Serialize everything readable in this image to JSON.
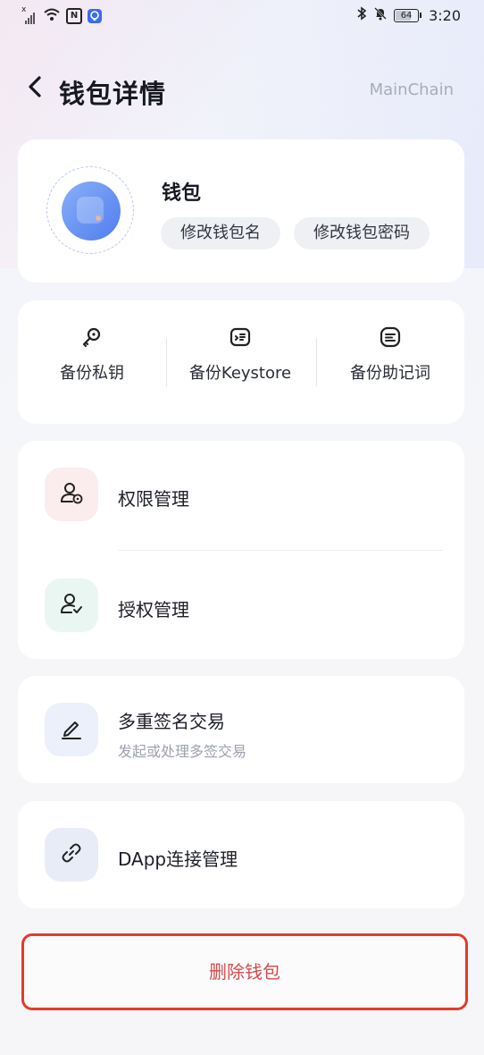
{
  "status_bar": {
    "time": "3:20",
    "battery": "64",
    "signal_marker": "x",
    "nfc": "N",
    "left_icons": [
      "signal-icon",
      "wifi-icon",
      "nfc-icon",
      "app-notification-icon"
    ],
    "right_icons": [
      "bluetooth-icon",
      "mute-bell-icon",
      "battery-icon"
    ]
  },
  "header": {
    "title": "钱包详情",
    "chain": "MainChain",
    "back_icon": "chevron-left-icon"
  },
  "wallet": {
    "name": "钱包",
    "rename_label": "修改钱包名",
    "change_password_label": "修改钱包密码",
    "avatar_color": "#5d89f2"
  },
  "backup": {
    "items": [
      {
        "label": "备份私钥",
        "icon": "key-icon"
      },
      {
        "label": "备份Keystore",
        "icon": "keystore-icon"
      },
      {
        "label": "备份助记词",
        "icon": "mnemonic-icon"
      }
    ]
  },
  "management": {
    "permissions": {
      "label": "权限管理",
      "icon": "user-permission-icon",
      "bg": "#fbecee"
    },
    "authorization": {
      "label": "授权管理",
      "icon": "user-check-icon",
      "bg": "#eaf6f1"
    }
  },
  "multisig": {
    "label": "多重签名交易",
    "subtitle": "发起或处理多签交易",
    "icon": "pen-icon",
    "bg": "#ebf0fb"
  },
  "dapp": {
    "label": "DApp连接管理",
    "icon": "link-icon",
    "bg": "#e8ecf6"
  },
  "delete": {
    "label": "删除钱包",
    "color": "#d34b4b",
    "highlight_border": "#e53a2a"
  }
}
